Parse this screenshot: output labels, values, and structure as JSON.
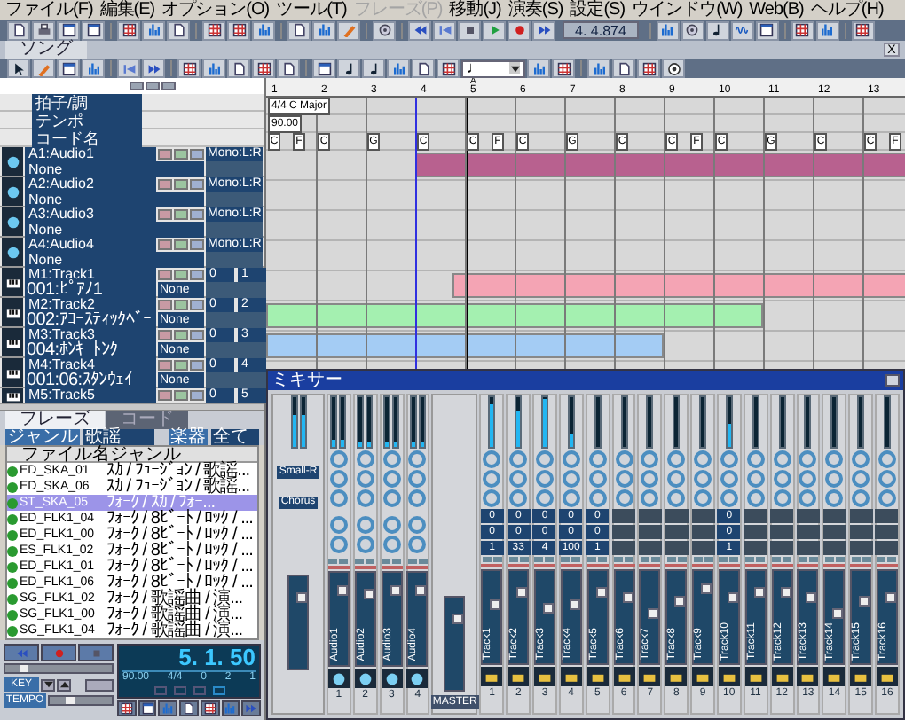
{
  "menu": [
    {
      "label": "ファイル(F)",
      "disabled": false
    },
    {
      "label": "編集(E)",
      "disabled": false
    },
    {
      "label": "オプション(O)",
      "disabled": false
    },
    {
      "label": "ツール(T)",
      "disabled": false
    },
    {
      "label": "フレーズ(P)",
      "disabled": true
    },
    {
      "label": "移動(J)",
      "disabled": false
    },
    {
      "label": "演奏(S)",
      "disabled": false
    },
    {
      "label": "設定(S)",
      "disabled": false
    },
    {
      "label": "ウインドウ(W)",
      "disabled": false
    },
    {
      "label": "Web(B)",
      "disabled": false
    },
    {
      "label": "ヘルプ(H)",
      "disabled": false
    }
  ],
  "toolbar": [
    {
      "kind": "button"
    },
    {
      "kind": "button"
    },
    {
      "kind": "button"
    },
    {
      "kind": "button"
    },
    {
      "kind": "sep"
    },
    {
      "kind": "button"
    },
    {
      "kind": "button"
    },
    {
      "kind": "button"
    },
    {
      "kind": "sep"
    },
    {
      "kind": "button"
    },
    {
      "kind": "button"
    },
    {
      "kind": "button"
    },
    {
      "kind": "sep"
    },
    {
      "kind": "button"
    },
    {
      "kind": "button"
    },
    {
      "kind": "button"
    },
    {
      "kind": "sep"
    },
    {
      "kind": "button"
    },
    {
      "kind": "sep"
    },
    {
      "kind": "button"
    },
    {
      "kind": "button"
    },
    {
      "kind": "button"
    },
    {
      "kind": "button"
    },
    {
      "kind": "button"
    },
    {
      "kind": "button"
    },
    {
      "kind": "display",
      "text": "4. 4.874"
    },
    {
      "kind": "sep"
    },
    {
      "kind": "button"
    },
    {
      "kind": "button"
    },
    {
      "kind": "button"
    },
    {
      "kind": "button"
    },
    {
      "kind": "button"
    },
    {
      "kind": "sep"
    },
    {
      "kind": "button"
    },
    {
      "kind": "button"
    },
    {
      "kind": "sep"
    },
    {
      "kind": "button"
    }
  ],
  "song_window": {
    "title": "ソング",
    "close": "X",
    "toolbar": [
      {
        "kind": "button"
      },
      {
        "kind": "button"
      },
      {
        "kind": "button"
      },
      {
        "kind": "button"
      },
      {
        "kind": "sep"
      },
      {
        "kind": "button"
      },
      {
        "kind": "button"
      },
      {
        "kind": "sep"
      },
      {
        "kind": "button"
      },
      {
        "kind": "button"
      },
      {
        "kind": "button"
      },
      {
        "kind": "button"
      },
      {
        "kind": "button"
      },
      {
        "kind": "sep"
      },
      {
        "kind": "button"
      },
      {
        "kind": "button"
      },
      {
        "kind": "button"
      },
      {
        "kind": "button"
      },
      {
        "kind": "button"
      },
      {
        "kind": "button"
      },
      {
        "kind": "dropdown",
        "text": "♩"
      },
      {
        "kind": "button"
      },
      {
        "kind": "button"
      },
      {
        "kind": "sep"
      },
      {
        "kind": "button"
      },
      {
        "kind": "button"
      },
      {
        "kind": "button"
      },
      {
        "kind": "button"
      }
    ],
    "header_rows": [
      "拍子/調",
      "テンポ",
      "コード名"
    ],
    "time_signature": "4/4 C Major",
    "tempo": "90.00",
    "marker": "A",
    "measures": [
      {
        "number": "1",
        "chords": [
          "C",
          "F"
        ]
      },
      {
        "number": "2",
        "chords": [
          "C"
        ]
      },
      {
        "number": "3",
        "chords": [
          "G"
        ]
      },
      {
        "number": "4",
        "chords": [
          "C"
        ]
      },
      {
        "number": "5",
        "chords": [
          "C",
          "F"
        ]
      },
      {
        "number": "6",
        "chords": [
          "C"
        ]
      },
      {
        "number": "7",
        "chords": [
          "G"
        ]
      },
      {
        "number": "8",
        "chords": [
          "C"
        ]
      },
      {
        "number": "9",
        "chords": [
          "C",
          "F"
        ]
      },
      {
        "number": "10",
        "chords": [
          "C"
        ]
      },
      {
        "number": "11",
        "chords": [
          "G"
        ]
      },
      {
        "number": "12",
        "chords": [
          "C"
        ]
      },
      {
        "number": "13",
        "chords": [
          "C",
          "F"
        ]
      }
    ],
    "tracks": [
      {
        "kind": "audio",
        "name": "A1:Audio1",
        "sub": "None",
        "output": "Mono:L:R",
        "clip": {
          "color": "#b8618f"
        }
      },
      {
        "kind": "audio",
        "name": "A2:Audio2",
        "sub": "None",
        "output": "Mono:L:R"
      },
      {
        "kind": "audio",
        "name": "A3:Audio3",
        "sub": "None",
        "output": "Mono:L:R"
      },
      {
        "kind": "audio",
        "name": "A4:Audio4",
        "sub": "None",
        "output": "Mono:L:R"
      },
      {
        "kind": "midi",
        "name": "M1:Track1",
        "sub": "001:ﾋﾟｱﾉ1",
        "port": "None",
        "values": [
          "0",
          "1"
        ],
        "clip": {
          "color": "#f4a4b4"
        }
      },
      {
        "kind": "midi",
        "name": "M2:Track2",
        "sub": "002:ｱｺｰｽﾃｨｯｸﾍﾞｰ",
        "port": "None",
        "values": [
          "0",
          "2"
        ],
        "clip": {
          "color": "#a4f0b0"
        }
      },
      {
        "kind": "midi",
        "name": "M3:Track3",
        "sub": "004:ﾎﾝｷｰﾄﾝｸ",
        "port": "None",
        "values": [
          "0",
          "3"
        ],
        "clip": {
          "color": "#a4ccf4"
        }
      },
      {
        "kind": "midi",
        "name": "M4:Track4",
        "sub": "001:06:ｽﾀﾝｳｪｲ",
        "port": "None",
        "values": [
          "0",
          "4"
        ]
      },
      {
        "kind": "midi",
        "name": "M5:Track5",
        "values": [
          "0",
          "5"
        ]
      }
    ]
  },
  "phrase_panel": {
    "tabs": [
      {
        "label": "フレーズ",
        "selected": true
      },
      {
        "label": "コード",
        "selected": false
      }
    ],
    "genre_label": "ジャンル",
    "genre": "歌謡",
    "instrument_label": "楽器",
    "instrument": "全て",
    "columns": [
      "ファイル名",
      "ジャンル"
    ],
    "rows": [
      {
        "file": "ED_SKA_01",
        "genre": "ｽｶ / ﾌｭｰｼﾞｮﾝ / 歌謡...",
        "selected": false
      },
      {
        "file": "ED_SKA_06",
        "genre": "ｽｶ / ﾌｭｰｼﾞｮﾝ / 歌謡...",
        "selected": false
      },
      {
        "file": "ST_SKA_05",
        "genre": "ﾌｫｰｸ / ｽｶ / ﾌｫｰ...",
        "selected": true
      },
      {
        "file": "ED_FLK1_04",
        "genre": "ﾌｫｰｸ / 8ﾋﾞｰﾄ / ﾛｯｸ / ...",
        "selected": false
      },
      {
        "file": "ED_FLK1_00",
        "genre": "ﾌｫｰｸ / 8ﾋﾞｰﾄ / ﾛｯｸ / ...",
        "selected": false
      },
      {
        "file": "ES_FLK1_02",
        "genre": "ﾌｫｰｸ / 8ﾋﾞｰﾄ / ﾛｯｸ / ...",
        "selected": false
      },
      {
        "file": "ED_FLK1_01",
        "genre": "ﾌｫｰｸ / 8ﾋﾞｰﾄ / ﾛｯｸ / ...",
        "selected": false
      },
      {
        "file": "ED_FLK1_06",
        "genre": "ﾌｫｰｸ / 8ﾋﾞｰﾄ / ﾛｯｸ / ...",
        "selected": false
      },
      {
        "file": "SG_FLK1_02",
        "genre": "ﾌｫｰｸ / 歌謡曲 / 演...",
        "selected": false
      },
      {
        "file": "SG_FLK1_00",
        "genre": "ﾌｫｰｸ / 歌謡曲 / 演...",
        "selected": false
      },
      {
        "file": "SG_FLK1_04",
        "genre": "ﾌｫｰｸ / 歌謡曲 / 演...",
        "selected": false
      }
    ]
  },
  "transport": {
    "position_slider": {
      "level": 0.15
    },
    "key_label": "KEY",
    "tempo_label": "TEMPO",
    "tempo_slider": {
      "level": 0.3
    },
    "position": "5. 1. 50",
    "readouts": [
      "90.00",
      "4/4",
      "0",
      "2",
      "1"
    ]
  },
  "mixer": {
    "title": "ミキサー",
    "effects": [
      "Small-R",
      "Chorus"
    ],
    "main_meter": {
      "level": 0.65
    },
    "main_fader": {
      "level": 0.8
    },
    "master": {
      "label": "MASTER",
      "fader": {
        "level": 0.8
      }
    },
    "strips": [
      {
        "kind": "audio",
        "label": "Audio1",
        "number": "1",
        "meter": {
          "level": 0.15
        },
        "fader": {
          "level": 0.85
        }
      },
      {
        "kind": "audio",
        "label": "Audio2",
        "number": "2",
        "meter": {
          "level": 0.1
        },
        "fader": {
          "level": 0.8
        }
      },
      {
        "kind": "audio",
        "label": "Audio3",
        "number": "3",
        "meter": {
          "level": 0.1
        },
        "fader": {
          "level": 0.85
        }
      },
      {
        "kind": "audio",
        "label": "Audio4",
        "number": "4",
        "meter": {
          "level": 0.1
        },
        "fader": {
          "level": 0.85
        }
      },
      {
        "kind": "midi",
        "label": "Track1",
        "number": "1",
        "active": true,
        "values": [
          "0",
          "0",
          "1"
        ],
        "meter": {
          "level": 0.85
        },
        "fader": {
          "level": 0.65
        }
      },
      {
        "kind": "midi",
        "label": "Track2",
        "number": "2",
        "active": true,
        "values": [
          "0",
          "0",
          "33"
        ],
        "meter": {
          "level": 0.7
        },
        "fader": {
          "level": 0.8
        }
      },
      {
        "kind": "midi",
        "label": "Track3",
        "number": "3",
        "active": true,
        "values": [
          "0",
          "0",
          "4"
        ],
        "meter": {
          "level": 0.95
        },
        "fader": {
          "level": 0.6
        }
      },
      {
        "kind": "midi",
        "label": "Track4",
        "number": "4",
        "active": true,
        "values": [
          "0",
          "0",
          "100"
        ],
        "meter": {
          "level": 0.25
        },
        "fader": {
          "level": 0.65
        }
      },
      {
        "kind": "midi",
        "label": "Track5",
        "number": "5",
        "active": true,
        "values": [
          "0",
          "0",
          "1"
        ],
        "meter": {
          "level": 0
        },
        "fader": {
          "level": 0.8
        }
      },
      {
        "kind": "midi",
        "label": "Track6",
        "number": "6",
        "active": false,
        "meter": {
          "level": 0
        },
        "fader": {
          "level": 0.75
        }
      },
      {
        "kind": "midi",
        "label": "Track7",
        "number": "7",
        "active": false,
        "meter": {
          "level": 0
        },
        "fader": {
          "level": 0.55
        }
      },
      {
        "kind": "midi",
        "label": "Track8",
        "number": "8",
        "active": false,
        "meter": {
          "level": 0
        },
        "fader": {
          "level": 0.7
        }
      },
      {
        "kind": "midi",
        "label": "Track9",
        "number": "9",
        "active": false,
        "meter": {
          "level": 0
        },
        "fader": {
          "level": 0.85
        }
      },
      {
        "kind": "midi",
        "label": "Track10",
        "number": "10",
        "active": true,
        "values": [
          "0",
          "0",
          "1"
        ],
        "meter": {
          "level": 0.45
        },
        "fader": {
          "level": 0.75
        }
      },
      {
        "kind": "midi",
        "label": "Track11",
        "number": "11",
        "active": false,
        "meter": {
          "level": 0
        },
        "fader": {
          "level": 0.8
        }
      },
      {
        "kind": "midi",
        "label": "Track12",
        "number": "12",
        "active": false,
        "meter": {
          "level": 0
        },
        "fader": {
          "level": 0.8
        }
      },
      {
        "kind": "midi",
        "label": "Track13",
        "number": "13",
        "active": false,
        "meter": {
          "level": 0
        },
        "fader": {
          "level": 0.75
        }
      },
      {
        "kind": "midi",
        "label": "Track14",
        "number": "14",
        "active": false,
        "meter": {
          "level": 0
        },
        "fader": {
          "level": 0.55
        }
      },
      {
        "kind": "midi",
        "label": "Track15",
        "number": "15",
        "active": false,
        "meter": {
          "level": 0
        },
        "fader": {
          "level": 0.7
        }
      },
      {
        "kind": "midi",
        "label": "Track16",
        "number": "16",
        "active": false,
        "meter": {
          "level": 0
        },
        "fader": {
          "level": 0.75
        }
      }
    ]
  }
}
